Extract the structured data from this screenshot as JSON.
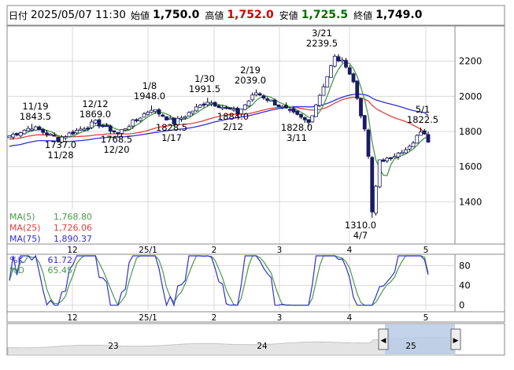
{
  "header": {
    "date_label": "日付",
    "datetime": "2025/05/07 11:30",
    "open_label": "始値",
    "open_value": "1,750.0",
    "high_label": "高値",
    "high_value": "1,752.0",
    "low_label": "安値",
    "low_value": "1,725.5",
    "close_label": "終値",
    "close_value": "1,749.0",
    "colors": {
      "high": "#d00000",
      "low": "#007000",
      "text": "#000000"
    }
  },
  "legend": [
    {
      "name": "MA(5)",
      "value": "1,768.80",
      "color": "#4a9a4a"
    },
    {
      "name": "MA(25)",
      "value": "1,726.06",
      "color": "#e04040"
    },
    {
      "name": "MA(75)",
      "value": "1,890.37",
      "color": "#3030d0"
    }
  ],
  "stoch_legend": [
    {
      "name": "%K",
      "value": "61.72",
      "color": "#3030d0"
    },
    {
      "name": "%D",
      "value": "65.45",
      "color": "#4a9a4a"
    }
  ],
  "annotations": [
    {
      "date": "11/19",
      "price": "1843.5",
      "kind": "high"
    },
    {
      "date": "11/28",
      "price": "1737.0",
      "kind": "low"
    },
    {
      "date": "12/12",
      "price": "1869.0",
      "kind": "high"
    },
    {
      "date": "12/20",
      "price": "1768.5",
      "kind": "low"
    },
    {
      "date": "1/8",
      "price": "1948.0",
      "kind": "high"
    },
    {
      "date": "1/17",
      "price": "1828.5",
      "kind": "low"
    },
    {
      "date": "1/30",
      "price": "1991.5",
      "kind": "high"
    },
    {
      "date": "2/12",
      "price": "1884.0",
      "kind": "low"
    },
    {
      "date": "2/19",
      "price": "2039.0",
      "kind": "high"
    },
    {
      "date": "3/11",
      "price": "1828.0",
      "kind": "low"
    },
    {
      "date": "3/21",
      "price": "2239.5",
      "kind": "high"
    },
    {
      "date": "4/7",
      "price": "1310.0",
      "kind": "low"
    },
    {
      "date": "5/1",
      "price": "1822.5",
      "kind": "high"
    }
  ],
  "navigator": {
    "years": [
      "23",
      "24",
      "25"
    ]
  },
  "chart_data": {
    "type": "candlestick",
    "price_axis": {
      "ticks": [
        1400,
        1600,
        1800,
        2000,
        2200
      ],
      "range": [
        1160,
        2400
      ]
    },
    "x_tick_labels": [
      "12",
      "25/1",
      "2",
      "3",
      "4",
      "5"
    ],
    "stoch_axis": {
      "ticks": [
        0,
        40,
        80
      ],
      "range": [
        -10,
        100
      ]
    },
    "key_points": [
      {
        "date": "11/19",
        "high": 1843.5
      },
      {
        "date": "11/28",
        "low": 1737.0
      },
      {
        "date": "12/12",
        "high": 1869.0
      },
      {
        "date": "12/20",
        "low": 1768.5
      },
      {
        "date": "1/8",
        "high": 1948.0
      },
      {
        "date": "1/17",
        "low": 1828.5
      },
      {
        "date": "1/30",
        "high": 1991.5
      },
      {
        "date": "2/12",
        "low": 1884.0
      },
      {
        "date": "2/19",
        "high": 2039.0
      },
      {
        "date": "3/11",
        "low": 1828.0
      },
      {
        "date": "3/21",
        "high": 2239.5
      },
      {
        "date": "4/7",
        "low": 1310.0
      },
      {
        "date": "5/1",
        "high": 1822.5
      }
    ],
    "latest": {
      "open": 1750.0,
      "high": 1752.0,
      "low": 1725.5,
      "close": 1749.0
    },
    "ma": [
      {
        "name": "MA(5)",
        "value": 1768.8
      },
      {
        "name": "MA(25)",
        "value": 1726.06
      },
      {
        "name": "MA(75)",
        "value": 1890.37
      }
    ],
    "stochastics": [
      {
        "name": "%K",
        "value": 61.72
      },
      {
        "name": "%D",
        "value": 65.45
      }
    ]
  }
}
